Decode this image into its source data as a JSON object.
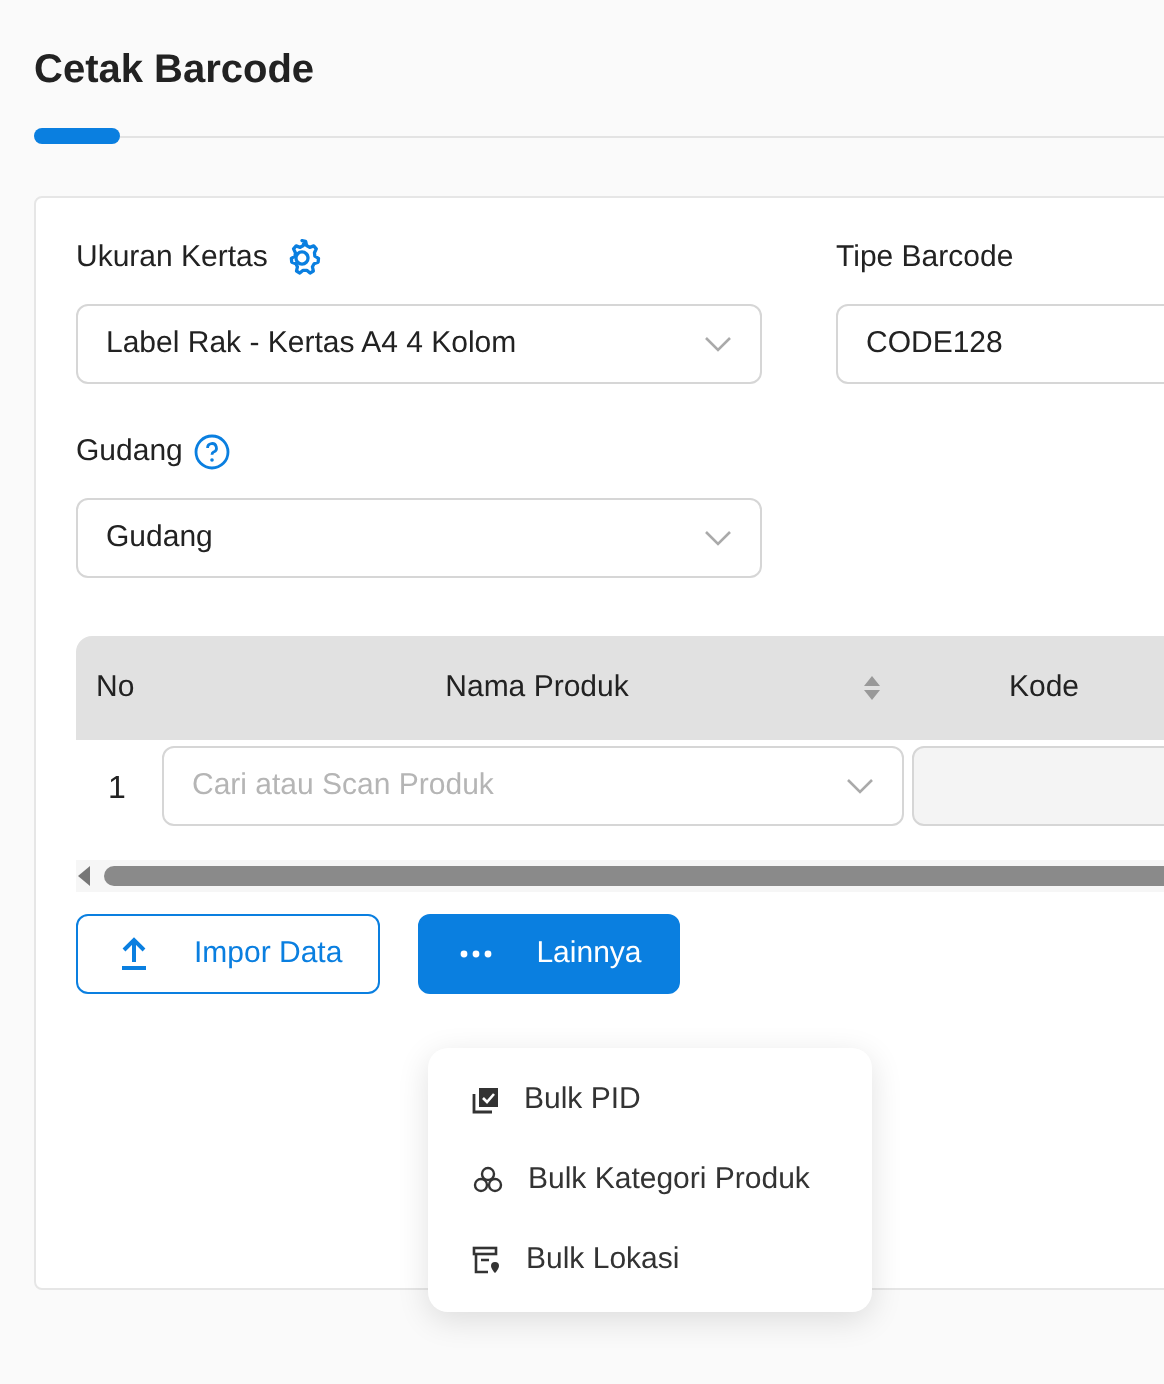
{
  "page": {
    "title": "Cetak Barcode"
  },
  "fields": [
    {
      "label": "Ukuran Kertas",
      "value": "Label Rak - Kertas A4 4 Kolom",
      "kind": "select"
    },
    {
      "label": "Tipe Barcode",
      "value": "CODE128",
      "kind": "text"
    },
    {
      "label": "Gudang",
      "value": "Gudang",
      "kind": "select"
    }
  ],
  "table": {
    "columns": [
      {
        "label": "No"
      },
      {
        "label": "Nama Produk",
        "sortable": true
      },
      {
        "label": "Kode"
      }
    ],
    "rows": [
      {
        "no": "1",
        "product_placeholder": "Cari atau Scan Produk"
      }
    ]
  },
  "buttons": [
    {
      "label": "Impor Data",
      "kind": "upload"
    },
    {
      "label": "Lainnya",
      "kind": "more"
    }
  ],
  "menu": {
    "open": true,
    "items": [
      {
        "label": "Bulk PID",
        "kind": "pid"
      },
      {
        "label": "Bulk Kategori Produk",
        "kind": "category"
      },
      {
        "label": "Bulk Lokasi",
        "kind": "location"
      }
    ]
  }
}
